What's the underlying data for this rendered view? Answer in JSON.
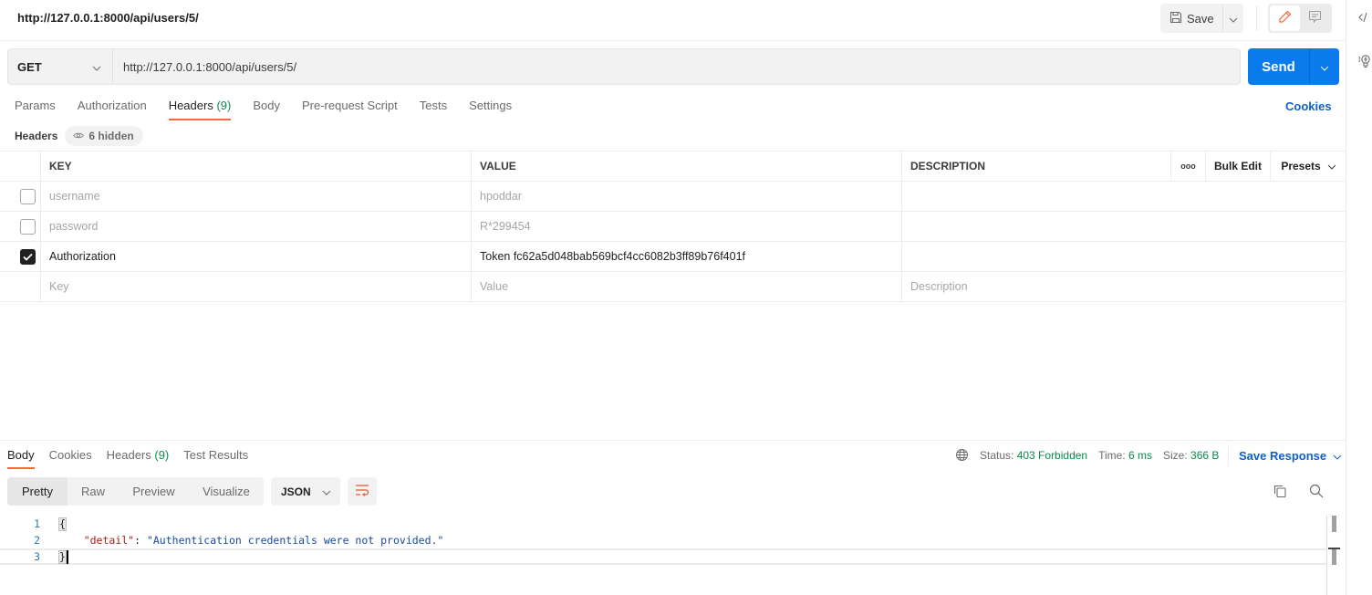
{
  "request": {
    "title": "http://127.0.0.1:8000/api/users/5/",
    "method": "GET",
    "url": "http://127.0.0.1:8000/api/users/5/",
    "save_label": "Save",
    "send_label": "Send",
    "cookies_label": "Cookies"
  },
  "request_tabs": [
    {
      "label": "Params",
      "count": ""
    },
    {
      "label": "Authorization",
      "count": ""
    },
    {
      "label": "Headers",
      "count": "(9)"
    },
    {
      "label": "Body",
      "count": ""
    },
    {
      "label": "Pre-request Script",
      "count": ""
    },
    {
      "label": "Tests",
      "count": ""
    },
    {
      "label": "Settings",
      "count": ""
    }
  ],
  "active_request_tab": "Headers",
  "headers_section": {
    "label": "Headers",
    "hidden_label": "6 hidden"
  },
  "headers_table": {
    "columns": {
      "key": "KEY",
      "value": "VALUE",
      "description": "DESCRIPTION"
    },
    "more_label": "ooo",
    "bulk_edit_label": "Bulk Edit",
    "presets_label": "Presets",
    "rows": [
      {
        "enabled": false,
        "key": "username",
        "value": "hpoddar",
        "description": ""
      },
      {
        "enabled": false,
        "key": "password",
        "value": "R*299454",
        "description": ""
      },
      {
        "enabled": true,
        "key": "Authorization",
        "value": "Token fc62a5d048bab569bcf4cc6082b3ff89b76f401f",
        "description": ""
      }
    ],
    "new_row": {
      "key_placeholder": "Key",
      "value_placeholder": "Value",
      "description_placeholder": "Description"
    }
  },
  "response": {
    "tabs": [
      {
        "label": "Body",
        "count": ""
      },
      {
        "label": "Cookies",
        "count": ""
      },
      {
        "label": "Headers",
        "count": "(9)"
      },
      {
        "label": "Test Results",
        "count": ""
      }
    ],
    "active_tab": "Body",
    "status_label": "Status:",
    "status_value": "403 Forbidden",
    "time_label": "Time:",
    "time_value": "6 ms",
    "size_label": "Size:",
    "size_value": "366 B",
    "save_response_label": "Save Response",
    "view_modes": [
      "Pretty",
      "Raw",
      "Preview",
      "Visualize"
    ],
    "active_view_mode": "Pretty",
    "format": "JSON",
    "body_lines": [
      {
        "num": "1",
        "open": "{"
      },
      {
        "num": "2",
        "key": "\"detail\"",
        "sep": ": ",
        "value": "\"Authentication credentials were not provided.\""
      },
      {
        "num": "3",
        "close": "}"
      }
    ]
  },
  "colors": {
    "accent_blue": "#097bed",
    "link_blue": "#0d62c8",
    "active_tab_underline": "#f26b3a",
    "status_green": "#0b8a4e"
  }
}
